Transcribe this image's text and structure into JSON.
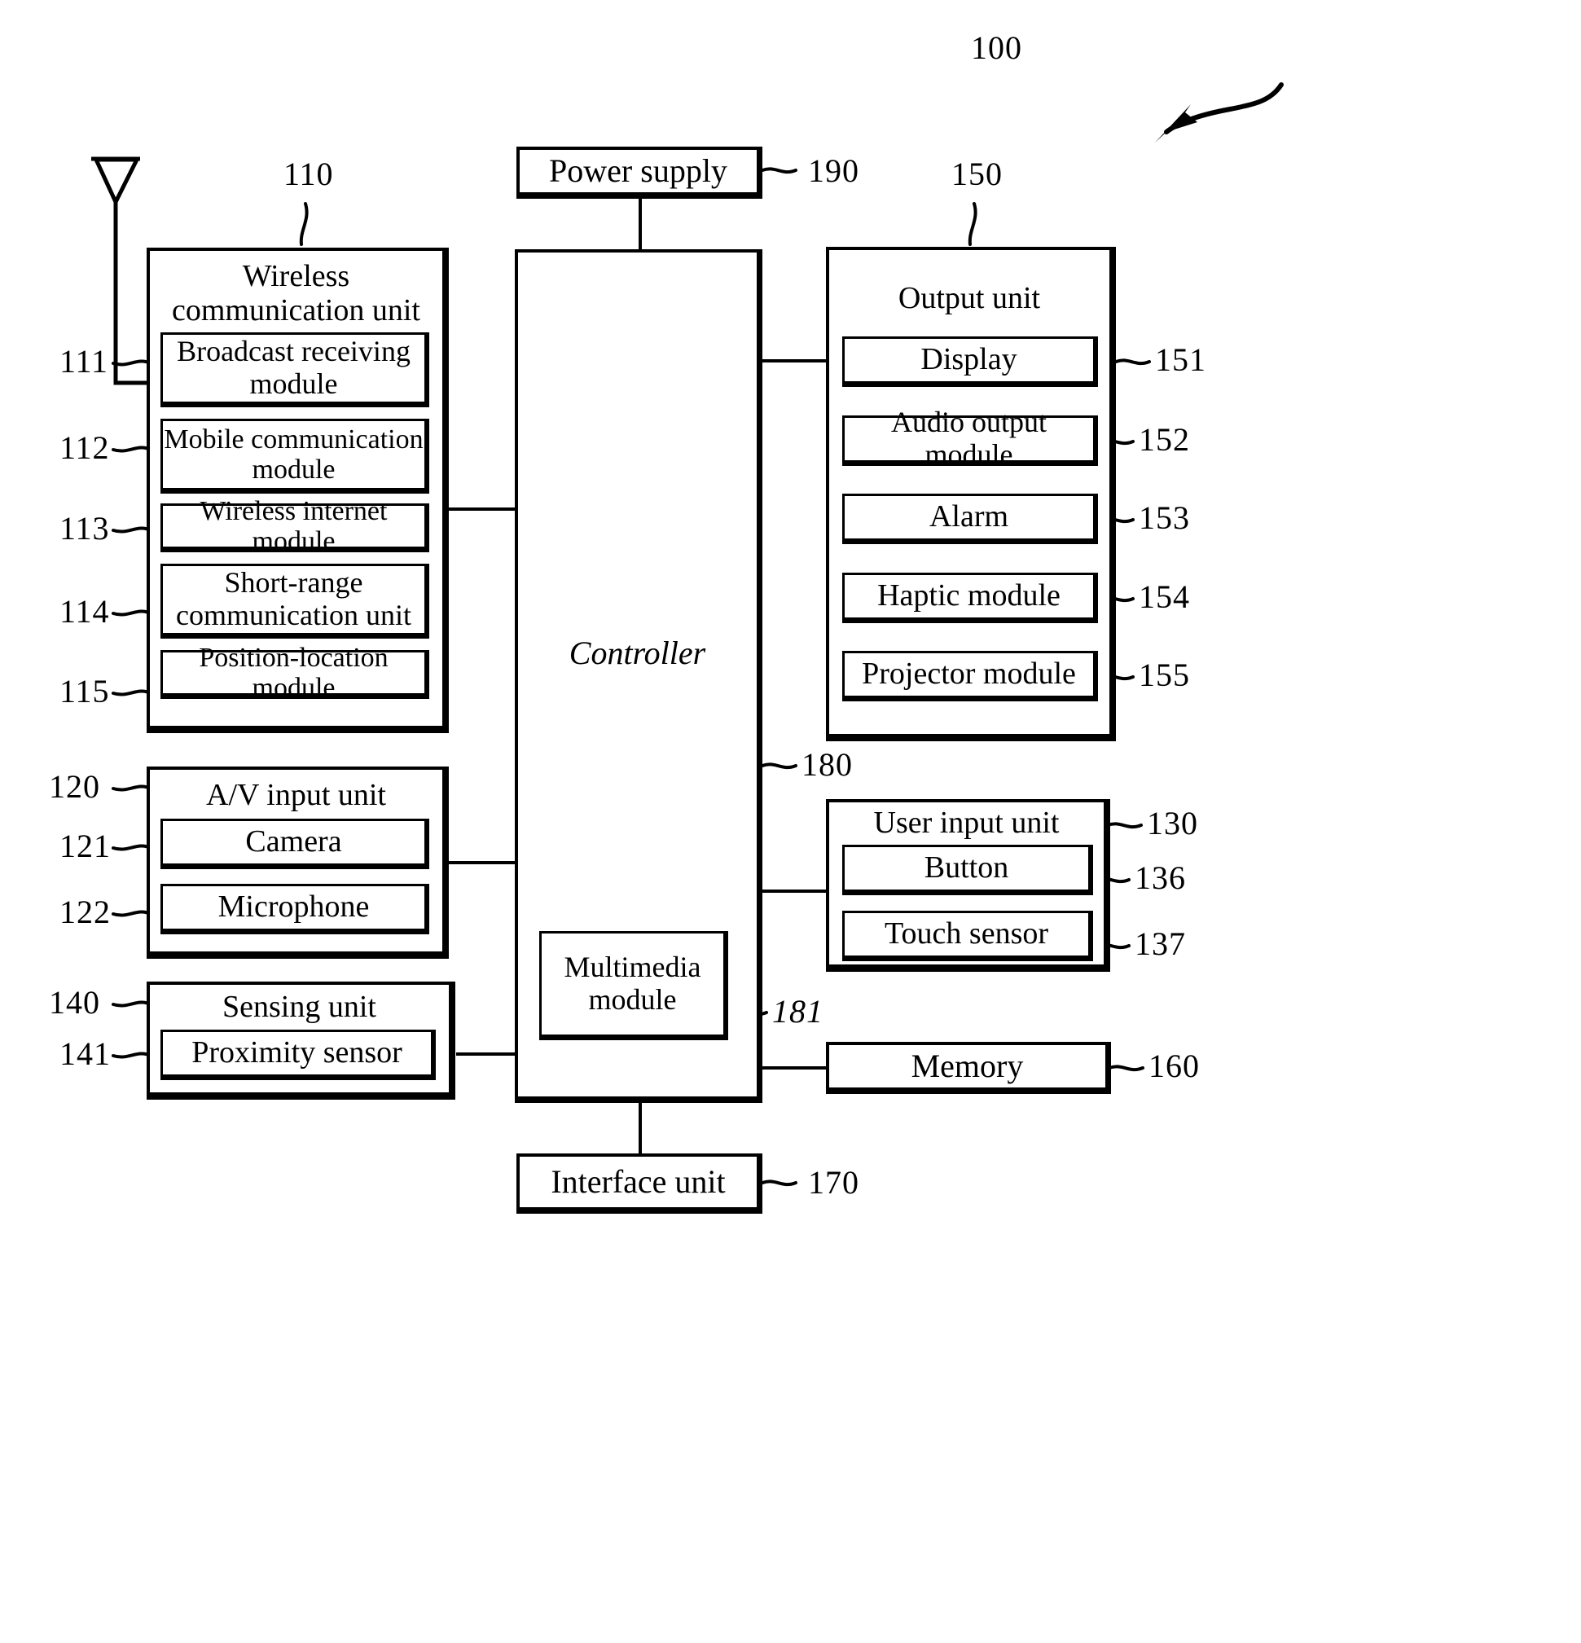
{
  "figure": {
    "device_ref": "100"
  },
  "power_supply": {
    "label": "Power supply",
    "ref": "190"
  },
  "controller": {
    "label": "Controller",
    "ref": "180",
    "multimedia": {
      "label": "Multimedia\nmodule",
      "label_line1": "Multimedia",
      "label_line2": "module",
      "ref": "181"
    }
  },
  "interface_unit": {
    "label": "Interface unit",
    "ref": "170"
  },
  "memory": {
    "label": "Memory",
    "ref": "160"
  },
  "wireless_communication_unit": {
    "title_line1": "Wireless",
    "title_line2": "communication unit",
    "ref": "110",
    "modules": [
      {
        "ref": "111",
        "line1": "Broadcast receiving",
        "line2": "module"
      },
      {
        "ref": "112",
        "line1": "Mobile communication",
        "line2": "module"
      },
      {
        "ref": "113",
        "line1": "Wireless internet module",
        "line2": ""
      },
      {
        "ref": "114",
        "line1": "Short-range",
        "line2": "communication unit"
      },
      {
        "ref": "115",
        "line1": "Position-location module",
        "line2": ""
      }
    ]
  },
  "av_input_unit": {
    "title": "A/V input unit",
    "ref": "120",
    "modules": [
      {
        "ref": "121",
        "label": "Camera"
      },
      {
        "ref": "122",
        "label": "Microphone"
      }
    ]
  },
  "sensing_unit": {
    "title": "Sensing unit",
    "ref": "140",
    "modules": [
      {
        "ref": "141",
        "label": "Proximity sensor"
      }
    ]
  },
  "output_unit": {
    "title": "Output unit",
    "ref": "150",
    "modules": [
      {
        "ref": "151",
        "label": "Display"
      },
      {
        "ref": "152",
        "label": "Audio output module"
      },
      {
        "ref": "153",
        "label": "Alarm"
      },
      {
        "ref": "154",
        "label": "Haptic module"
      },
      {
        "ref": "155",
        "label": "Projector module"
      }
    ]
  },
  "user_input_unit": {
    "title": "User input unit",
    "ref": "130",
    "modules": [
      {
        "ref": "136",
        "label": "Button"
      },
      {
        "ref": "137",
        "label": "Touch sensor"
      }
    ]
  },
  "antenna": {
    "name": "antenna-symbol"
  },
  "colors": {
    "ink": "#000000",
    "paper": "#ffffff"
  }
}
